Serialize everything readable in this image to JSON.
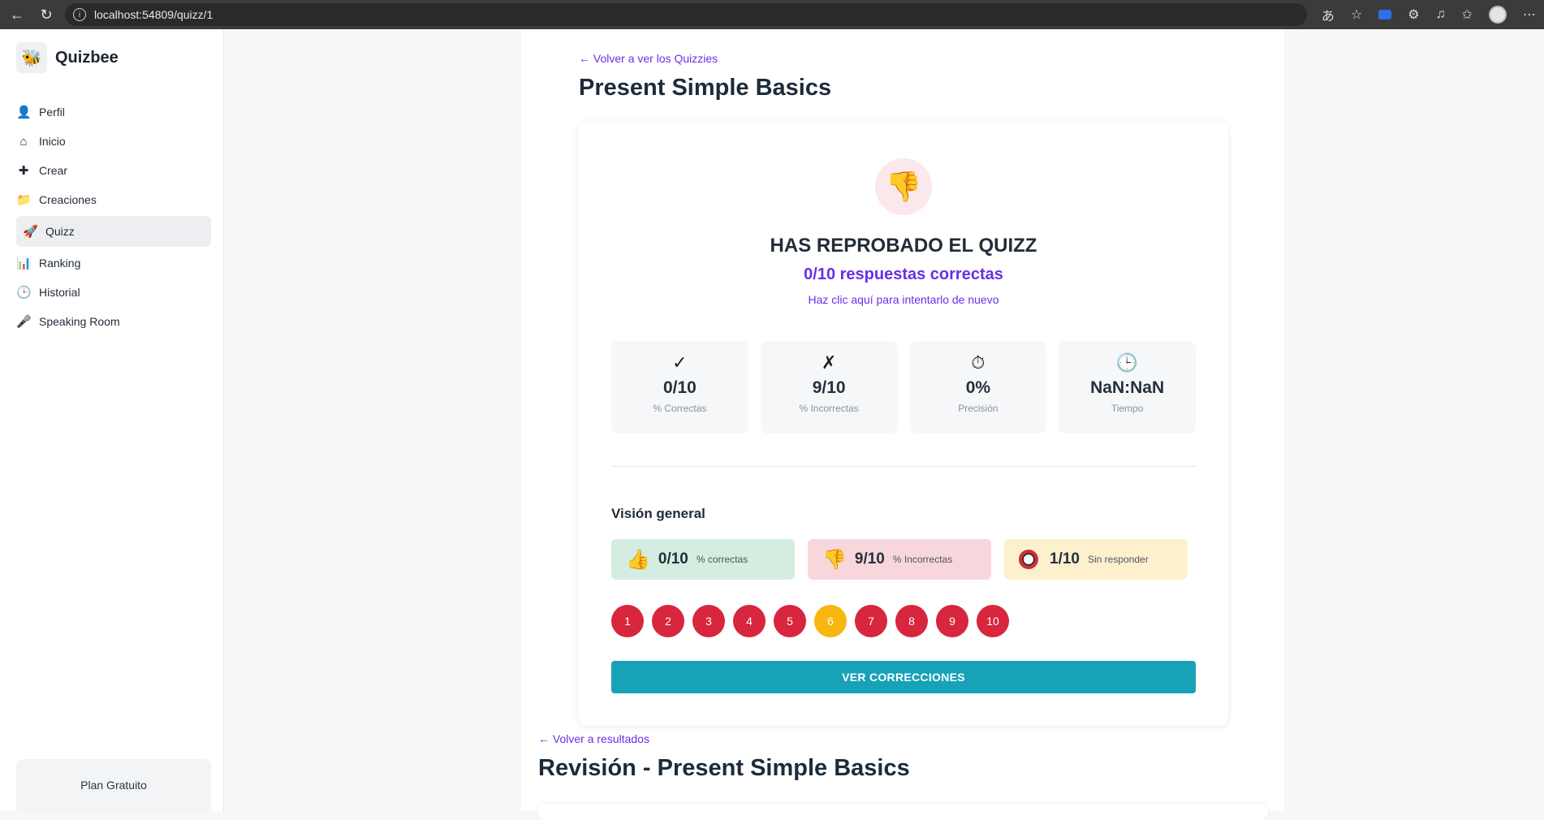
{
  "browser": {
    "url": "localhost:54809/quizz/1"
  },
  "sidebar": {
    "brand": "Quizbee",
    "items": [
      {
        "label": "Perfil",
        "icon": "person-icon"
      },
      {
        "label": "Inicio",
        "icon": "home-icon"
      },
      {
        "label": "Crear",
        "icon": "plus-icon"
      },
      {
        "label": "Creaciones",
        "icon": "folder-icon"
      },
      {
        "label": "Quizz",
        "icon": "rocket-icon",
        "active": true
      },
      {
        "label": "Ranking",
        "icon": "bar-chart-icon"
      },
      {
        "label": "Historial",
        "icon": "clock-icon"
      },
      {
        "label": "Speaking Room",
        "icon": "microphone-icon"
      }
    ],
    "plan": "Plan Gratuito"
  },
  "main": {
    "back_link": "← Volver a ver los Quizzies",
    "title": "Present Simple Basics",
    "result": {
      "headline": "HAS REPROBADO EL QUIZZ",
      "score": "0/10 respuestas correctas",
      "retry": "Haz clic aquí para intentarlo de nuevo"
    },
    "stats": [
      {
        "icon": "✓",
        "value": "0/10",
        "label": "% Correctas"
      },
      {
        "icon": "✗",
        "value": "9/10",
        "label": "% Incorrectas"
      },
      {
        "icon": "⏱",
        "value": "0%",
        "label": "Precisión"
      },
      {
        "icon": "🕒",
        "value": "NaN:NaN",
        "label": "Tiempo"
      }
    ],
    "overview": {
      "title": "Visión general",
      "correct": {
        "value": "0/10",
        "label": "% correctas"
      },
      "incorrect": {
        "value": "9/10",
        "label": "% Incorrectas"
      },
      "unanswered": {
        "value": "1/10",
        "label": "Sin responder"
      }
    },
    "questions": [
      {
        "n": "1",
        "status": "incorrect"
      },
      {
        "n": "2",
        "status": "incorrect"
      },
      {
        "n": "3",
        "status": "incorrect"
      },
      {
        "n": "4",
        "status": "incorrect"
      },
      {
        "n": "5",
        "status": "incorrect"
      },
      {
        "n": "6",
        "status": "unanswered"
      },
      {
        "n": "7",
        "status": "incorrect"
      },
      {
        "n": "8",
        "status": "incorrect"
      },
      {
        "n": "9",
        "status": "incorrect"
      },
      {
        "n": "10",
        "status": "incorrect"
      }
    ],
    "review_button": "VER CORRECCIONES",
    "review_back_link": "← Volver a resultados",
    "review_title": "Revisión - Present Simple Basics"
  },
  "colors": {
    "accent": "#6a2ee8",
    "incorrect": "#d7263d",
    "unanswered": "#f7b70f",
    "button": "#17a2b8"
  }
}
